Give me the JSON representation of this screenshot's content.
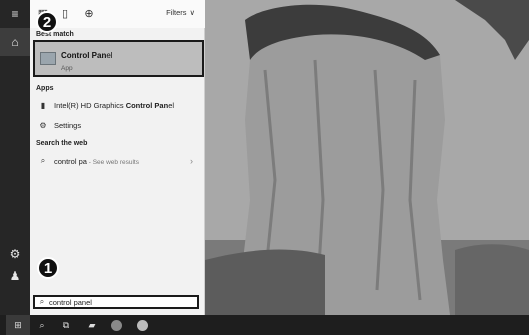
{
  "strip": {
    "menu_icon": "hamburger-menu-icon",
    "home_icon": "home-icon",
    "settings_icon": "gear-icon",
    "user_icon": "person-icon"
  },
  "panel_top": {
    "filters_label": "Filters"
  },
  "sections": {
    "best_match": "Best match",
    "apps": "Apps",
    "web": "Search the web"
  },
  "best_match_item": {
    "title_bold": "Control Pan",
    "title_rest": "el",
    "subtitle": "App"
  },
  "apps": [
    {
      "icon": "graphics-icon",
      "prefix": "Intel(R) HD Graphics ",
      "bold": "Control Pan",
      "suffix": "el"
    },
    {
      "icon": "settings-icon",
      "prefix": "Settings",
      "bold": "",
      "suffix": ""
    }
  ],
  "web": {
    "query": "control pa",
    "hint": " - See web results"
  },
  "callouts": {
    "one": "1",
    "two": "2"
  },
  "search": {
    "value": "control panel"
  },
  "taskbar": [
    "start",
    "search",
    "task-view",
    "file-explorer",
    "media",
    "chrome"
  ]
}
